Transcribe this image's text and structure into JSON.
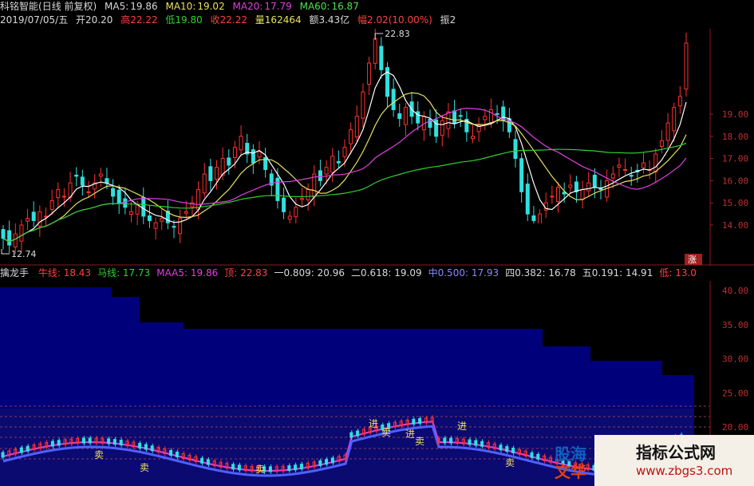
{
  "stock": {
    "name": "科铭智能",
    "period": "(日线 前复权)",
    "ma": [
      {
        "label": "MA5:",
        "value": "19.86"
      },
      {
        "label": "MA10:",
        "value": "19.02"
      },
      {
        "label": "MA20:",
        "value": "17.79"
      },
      {
        "label": "MA60:",
        "value": "16.87"
      }
    ]
  },
  "quote": {
    "date": "2019/07/05/五",
    "open": "开20.20",
    "high": "高22.22",
    "low": "低19.80",
    "close": "收22.22",
    "volume": "量162464",
    "amount": "额3.43亿",
    "change": "幅2.02(10.00%)",
    "swing": "振2"
  },
  "annotations": {
    "peak": "22.83",
    "trough": "12.74",
    "zhang": "涨"
  },
  "main_axis": {
    "ticks": [
      "19.00",
      "18.00",
      "17.00",
      "16.00",
      "15.00",
      "14.00"
    ]
  },
  "indicator": {
    "name": "擒龙手",
    "items": [
      {
        "text": "牛线: 18.43",
        "color": "#ff4040"
      },
      {
        "text": "马线: 17.73",
        "color": "#30d030"
      },
      {
        "text": "MAA5: 19.86",
        "color": "#e040e0"
      },
      {
        "text": "顶: 22.83",
        "color": "#ff4040"
      },
      {
        "text": "一0.809: 20.96",
        "color": "#d8d8d8"
      },
      {
        "text": "二0.618: 19.09",
        "color": "#d8d8d8"
      },
      {
        "text": "中0.500: 17.93",
        "color": "#8888ff"
      },
      {
        "text": "四0.382: 16.78",
        "color": "#d8d8d8"
      },
      {
        "text": "五0.191: 14.91",
        "color": "#d8d8d8"
      },
      {
        "text": "低: 13.0",
        "color": "#ff4040"
      }
    ]
  },
  "sub_axis": {
    "ticks": [
      "40.00",
      "35.00",
      "30.00",
      "25.00",
      "20.00"
    ]
  },
  "signals": {
    "buy": "进",
    "sell": "卖"
  },
  "watermark": {
    "logo_line1": "股海",
    "logo_line2": "文华",
    "title": "指标公式网",
    "url": "www.zbgs3.com"
  },
  "colors": {
    "up": "#ff3030",
    "down": "#30e0e0",
    "ma5": "#ffffff",
    "ma10": "#e8e060",
    "ma20": "#e040e0",
    "ma60": "#30d030",
    "sub_fill": "#00007a",
    "sub_grid": "#8a3a5a"
  }
}
